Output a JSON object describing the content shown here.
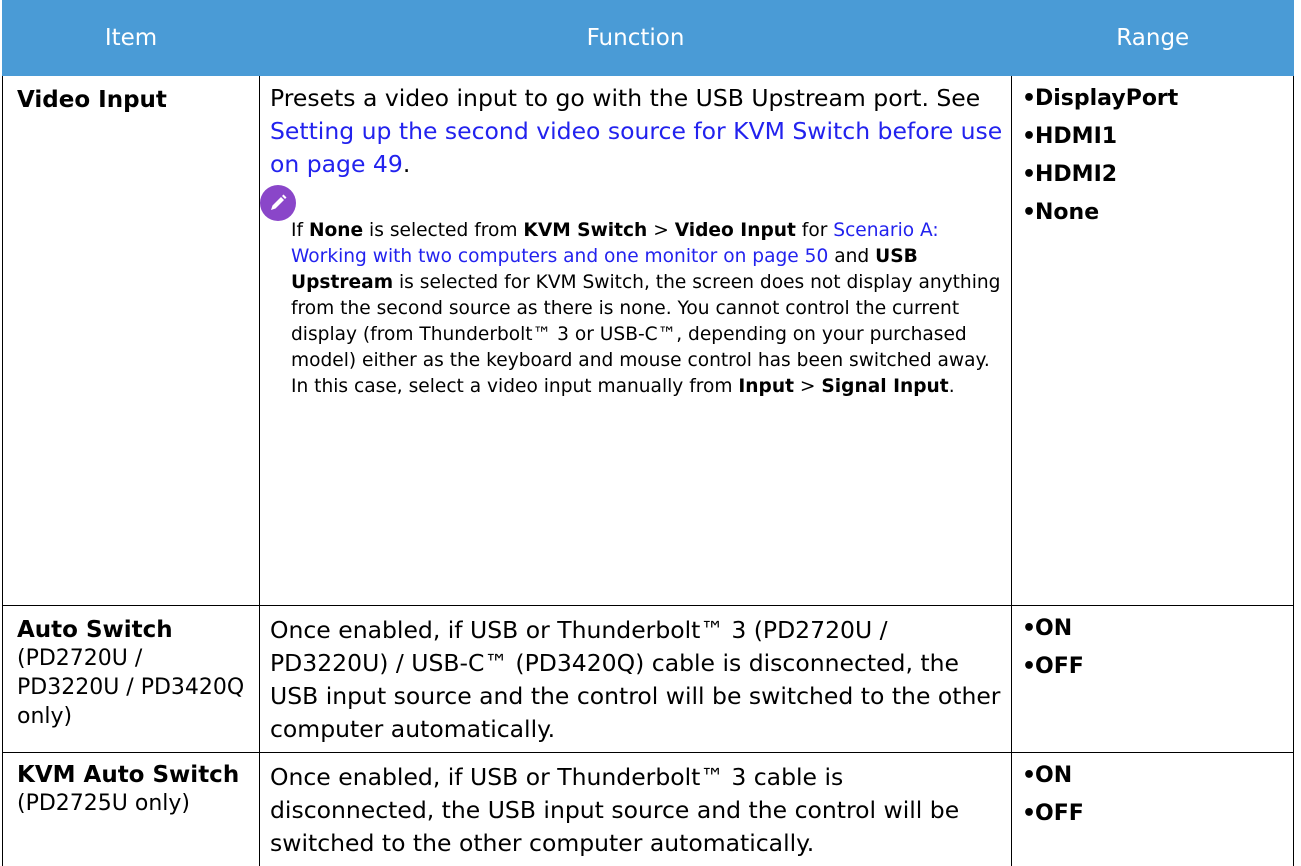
{
  "header": {
    "item": "Item",
    "function": "Function",
    "range": "Range"
  },
  "rows": [
    {
      "item": "Video Input",
      "function_text": "Presets a video input to go with the USB Upstream port. See ",
      "function_link": "Setting up the second video source for KVM Switch before use on page 49",
      "function_end": ".",
      "note": {
        "p1": "If ",
        "b1": "None",
        "p2": " is selected from ",
        "b2": "KVM Switch",
        "p3": " > ",
        "b3": "Video Input",
        "p4": " for ",
        "link": "Scenario A: Working with two computers and one monitor on page 50",
        "p5": " and ",
        "b4": "USB Upstream",
        "p6": " is selected for KVM Switch, the screen does not display anything from the second source as there is none. You cannot control the current display (from Thunderbolt™ 3 or USB-C™, depending on your purchased model) either as the keyboard and mouse control has been switched away. In this case, select a video input manually from ",
        "b5": "Input",
        "p7": " > ",
        "b6": "Signal Input",
        "p8": "."
      },
      "range": [
        "DisplayPort",
        "HDMI1",
        "HDMI2",
        "None"
      ]
    },
    {
      "item": "Auto Switch",
      "item_sub": "(PD2720U / PD3220U / PD3420Q only)",
      "function": "Once enabled, if USB or Thunderbolt™ 3 (PD2720U / PD3220U) / USB-C™ (PD3420Q) cable is disconnected, the USB input source and the control will be switched to the other computer automatically.",
      "range": [
        "ON",
        "OFF"
      ]
    },
    {
      "item": "KVM Auto Switch",
      "item_sub": "(PD2725U only)",
      "function": "Once enabled, if USB or Thunderbolt™ 3 cable is disconnected, the USB input source and the control will be switched to the other computer automatically.",
      "range": [
        "ON",
        "OFF"
      ]
    }
  ],
  "bullet": "•",
  "colors": {
    "header_bg": "#4a9bd6",
    "link": "#2222ee",
    "note_icon": "#8a46c9"
  },
  "icons": {
    "note": "pencil-note-icon"
  }
}
